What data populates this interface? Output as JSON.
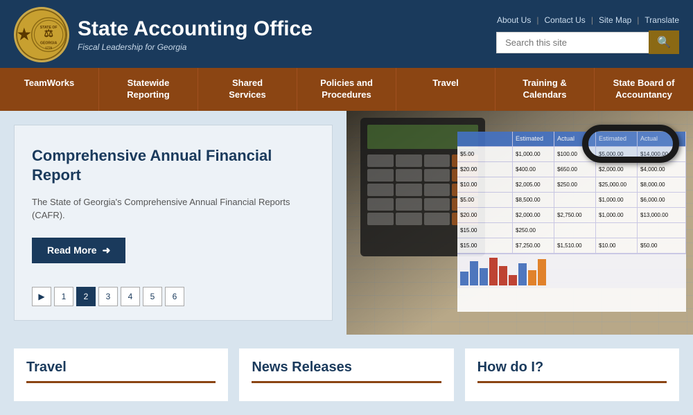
{
  "header": {
    "site_title": "State Accounting Office",
    "tagline": "Fiscal Leadership for Georgia",
    "top_links": [
      "About Us",
      "Contact Us",
      "Site Map",
      "Translate"
    ],
    "search_placeholder": "Search this site"
  },
  "nav": {
    "items": [
      {
        "id": "teamworks",
        "label": "TeamWorks"
      },
      {
        "id": "statewide-reporting",
        "label": "Statewide\nReporting"
      },
      {
        "id": "shared-services",
        "label": "Shared\nServices"
      },
      {
        "id": "policies-procedures",
        "label": "Policies and\nProcedures"
      },
      {
        "id": "travel",
        "label": "Travel"
      },
      {
        "id": "training-calendars",
        "label": "Training &\nCalendars"
      },
      {
        "id": "state-board",
        "label": "State Board of\nAccountancy"
      }
    ]
  },
  "slideshow": {
    "title": "Comprehensive Annual Financial Report",
    "description": "The State of Georgia's Comprehensive Annual Financial Reports (CAFR).",
    "read_more_label": "Read More",
    "pages": [
      "▶",
      "1",
      "2",
      "3",
      "4",
      "5",
      "6"
    ],
    "active_page": "2"
  },
  "bottom_sections": [
    {
      "id": "travel",
      "title": "Travel"
    },
    {
      "id": "news-releases",
      "title": "News Releases"
    },
    {
      "id": "how-do-i",
      "title": "How do I?"
    }
  ],
  "colors": {
    "navy": "#1a3a5c",
    "brown": "#8b4513",
    "light_bg": "#d8e4ee"
  }
}
